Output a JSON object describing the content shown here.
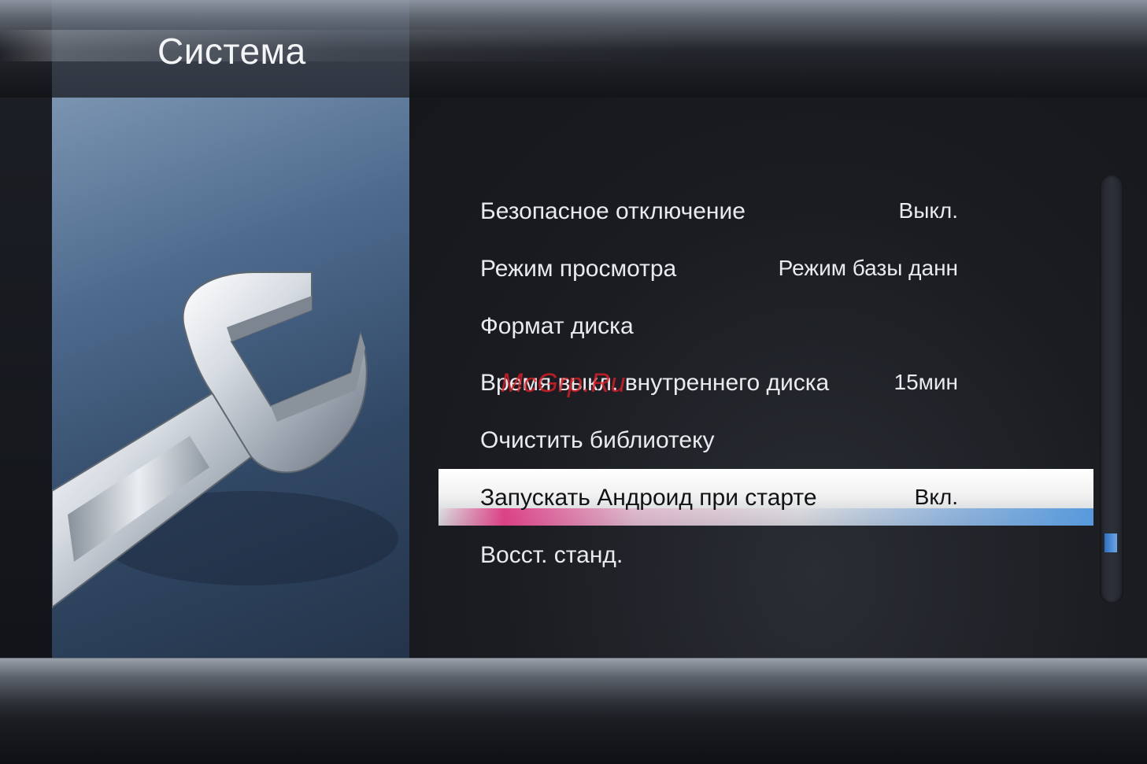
{
  "header": {
    "title": "Система"
  },
  "menu": {
    "items": [
      {
        "label": "Безопасное отключение",
        "value": "Выкл."
      },
      {
        "label": "Режим просмотра",
        "value": "Режим базы данн"
      },
      {
        "label": "Формат диска",
        "value": ""
      },
      {
        "label": "Время выкл. внутреннего диска",
        "value": "15мин"
      },
      {
        "label": "Очистить библиотеку",
        "value": ""
      },
      {
        "label": "Запускать Андроид при старте",
        "value": "Вкл.",
        "selected": true
      },
      {
        "label": "Восст. станд.",
        "value": ""
      }
    ]
  },
  "illustration": {
    "icon": "wrench-icon"
  },
  "watermark": {
    "text": "McGrp.Ru"
  },
  "colors": {
    "highlight": "#f2f2f3",
    "scroll_thumb": "#4a8ad6",
    "text": "#e9ebee"
  }
}
